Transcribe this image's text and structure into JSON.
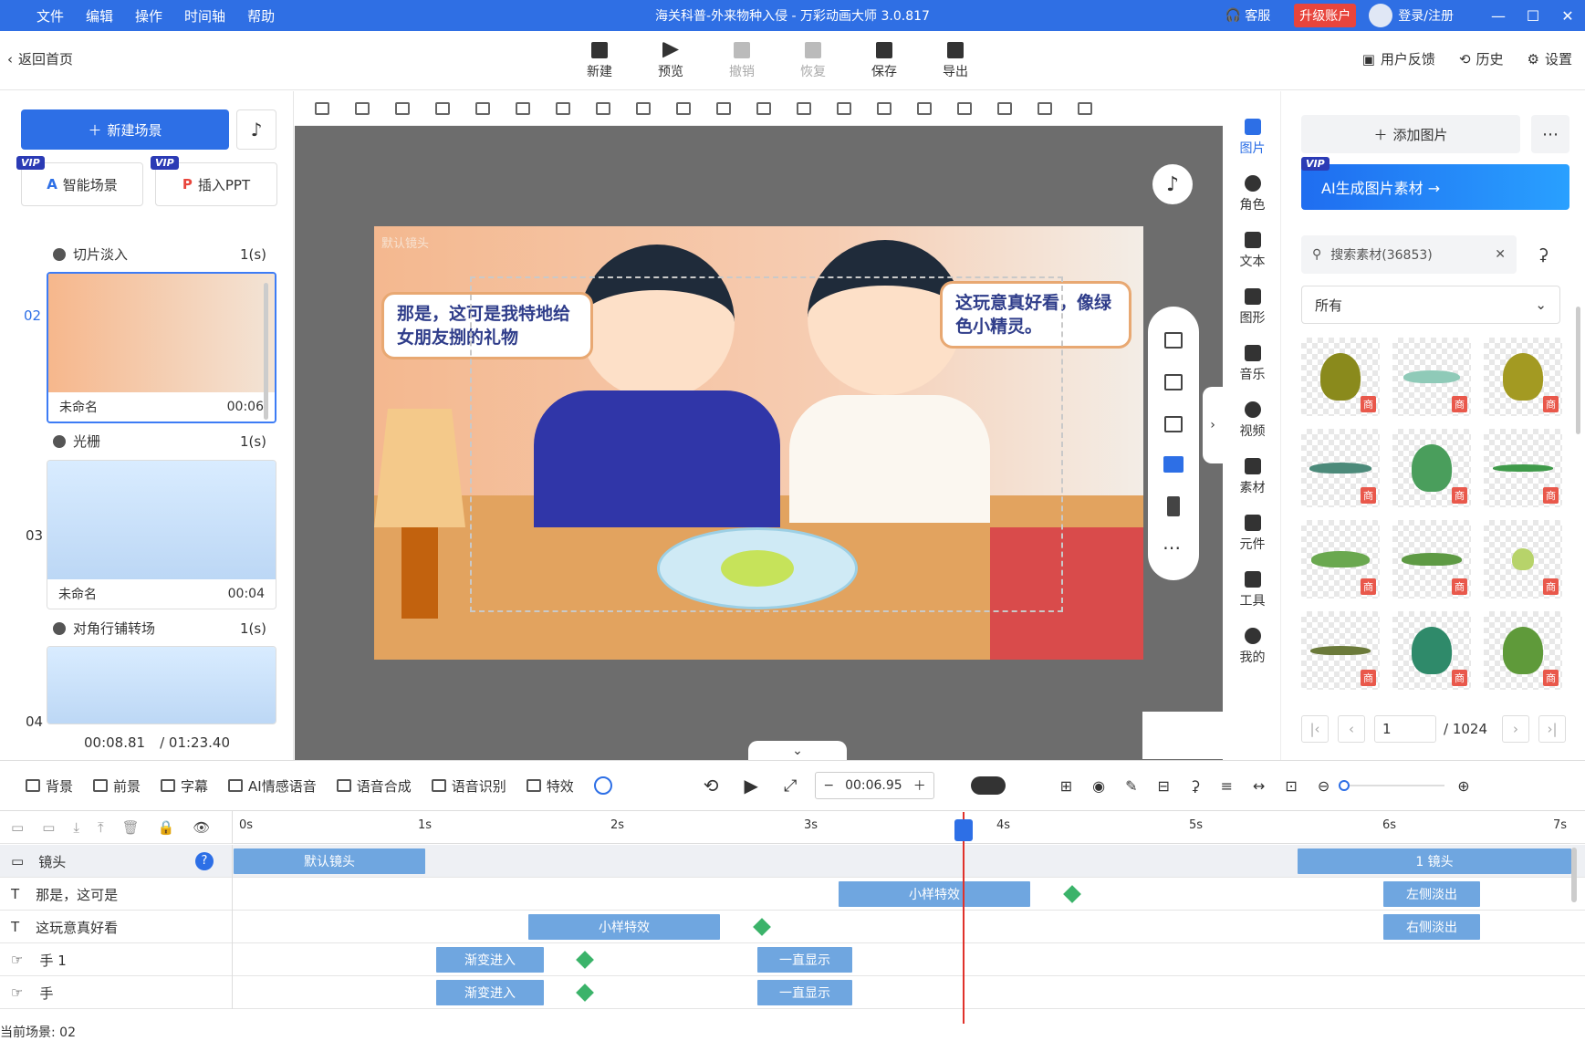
{
  "window": {
    "title": "海关科普-外来物种入侵 - 万彩动画大师 3.0.817",
    "menu": [
      "文件",
      "编辑",
      "操作",
      "时间轴",
      "帮助"
    ],
    "service": "客服",
    "upgrade": "升级账户",
    "login": "登录/注册"
  },
  "toolbar": {
    "back": "返回首页",
    "buttons": [
      {
        "label": "新建",
        "enabled": true
      },
      {
        "label": "预览",
        "enabled": true
      },
      {
        "label": "撤销",
        "enabled": false
      },
      {
        "label": "恢复",
        "enabled": false
      },
      {
        "label": "保存",
        "enabled": true
      },
      {
        "label": "导出",
        "enabled": true
      }
    ],
    "feedback": "用户反馈",
    "history": "历史",
    "settings": "设置"
  },
  "left": {
    "new_scene": "新建场景",
    "smart_scene": "智能场景",
    "insert_ppt": "插入PPT",
    "vip": "VIP",
    "transitions": [
      {
        "name": "切片淡入",
        "dur": "1(s)"
      },
      {
        "name": "光栅",
        "dur": "1(s)"
      },
      {
        "name": "对角行铺转场",
        "dur": "1(s)"
      }
    ],
    "scenes": [
      {
        "num": "02",
        "name": "未命名",
        "time": "00:06"
      },
      {
        "num": "03",
        "name": "未命名",
        "time": "00:04"
      },
      {
        "num": "04"
      }
    ],
    "current_time": "00:08.81",
    "total_time": "/ 01:23.40"
  },
  "canvas": {
    "camera_label": "默认镜头",
    "bubble_left": "那是，这可是我特地给女朋友捌的礼物",
    "bubble_right": "这玩意真好看，像绿色小精灵。"
  },
  "iconcol": [
    {
      "label": "图片",
      "active": true
    },
    {
      "label": "角色"
    },
    {
      "label": "文本"
    },
    {
      "label": "图形"
    },
    {
      "label": "音乐"
    },
    {
      "label": "视频"
    },
    {
      "label": "素材"
    },
    {
      "label": "元件"
    },
    {
      "label": "工具"
    },
    {
      "label": "我的"
    }
  ],
  "assets": {
    "add_image": "添加图片",
    "ai_banner": "AI生成图片素材 →",
    "search_placeholder": "搜索素材(36853)",
    "filter": "所有",
    "tag": "商",
    "page": "1",
    "total_pages": "/ 1024"
  },
  "timeline": {
    "tools": [
      "背景",
      "前景",
      "字幕",
      "AI情感语音",
      "语音合成",
      "语音识别",
      "特效"
    ],
    "time": "00:06.95",
    "ruler": [
      "0s",
      "1s",
      "2s",
      "3s",
      "4s",
      "5s",
      "6s",
      "7s"
    ],
    "current_scene": "当前场景: 02",
    "tracks": [
      {
        "name": "镜头",
        "clips": [
          "默认镜头",
          "1 镜头"
        ]
      },
      {
        "name": "那是，这可是",
        "clips": [
          "小样特效",
          "左侧淡出"
        ]
      },
      {
        "name": "这玩意真好看",
        "clips": [
          "小样特效",
          "右侧淡出"
        ]
      },
      {
        "name": "手 1",
        "clips": [
          "渐变进入",
          "一直显示"
        ]
      },
      {
        "name": "手",
        "clips": [
          "渐变进入",
          "一直显示"
        ]
      }
    ]
  },
  "colors": {
    "primary": "#2d6fe6",
    "titlebar": "#2f6fe4",
    "playhead": "#e0322b",
    "clip": "#6fa6e0",
    "keyframe": "#3bb36a"
  }
}
